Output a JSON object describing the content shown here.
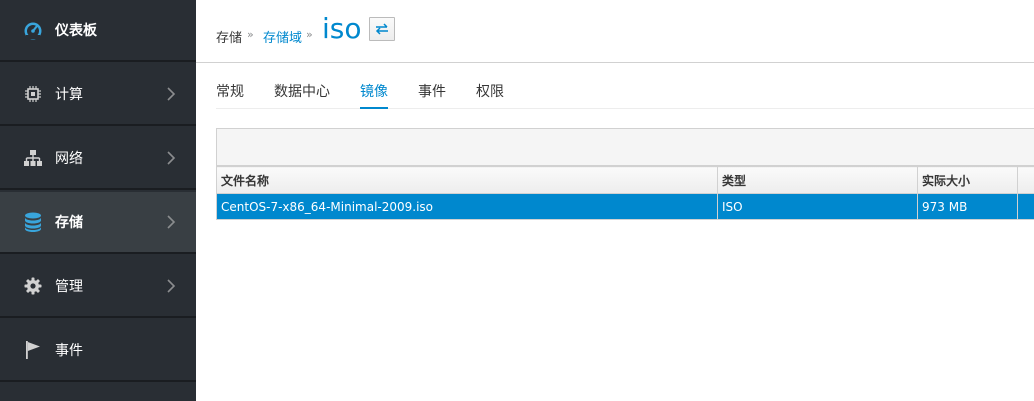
{
  "sidebar": {
    "items": [
      {
        "label": "仪表板",
        "icon": "dashboard-icon",
        "has_chevron": false
      },
      {
        "label": "计算",
        "icon": "chip-icon",
        "has_chevron": true
      },
      {
        "label": "网络",
        "icon": "network-icon",
        "has_chevron": true
      },
      {
        "label": "存储",
        "icon": "database-icon",
        "has_chevron": true
      },
      {
        "label": "管理",
        "icon": "gear-icon",
        "has_chevron": true
      },
      {
        "label": "事件",
        "icon": "flag-icon",
        "has_chevron": false
      }
    ]
  },
  "header": {
    "breadcrumb": [
      "存储",
      "存储域"
    ],
    "separator": "»",
    "title": "iso",
    "toggle_icon": "swap-arrows-icon"
  },
  "tabs": [
    "常规",
    "数据中心",
    "镜像",
    "事件",
    "权限"
  ],
  "active_tab": "镜像",
  "table": {
    "columns": [
      "文件名称",
      "类型",
      "实际大小"
    ],
    "rows": [
      [
        "CentOS-7-x86_64-Minimal-2009.iso",
        "ISO",
        "973 MB"
      ]
    ]
  },
  "colors": {
    "sidebar_bg": "#292e34",
    "sidebar_active_bg": "#393f44",
    "accent": "#0088ce"
  }
}
